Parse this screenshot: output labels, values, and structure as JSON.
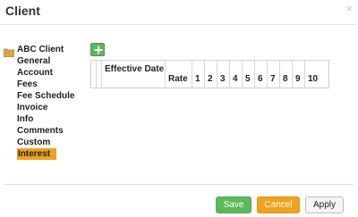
{
  "dialog": {
    "title": "Client",
    "close_glyph": "×"
  },
  "sidebar": {
    "root": {
      "label": "ABC Client",
      "icon": "folder-icon"
    },
    "items": [
      {
        "label": "General"
      },
      {
        "label": "Account"
      },
      {
        "label": "Fees"
      },
      {
        "label": "Fee Schedule"
      },
      {
        "label": "Invoice"
      },
      {
        "label": "Info"
      },
      {
        "label": "Comments"
      },
      {
        "label": "Custom"
      },
      {
        "label": "Interest",
        "selected": true
      }
    ]
  },
  "toolbar": {
    "add_icon": "plus-icon"
  },
  "grid": {
    "columns": [
      {
        "label": ""
      },
      {
        "label": ""
      },
      {
        "label": "Effective Date"
      },
      {
        "label": "Rate"
      },
      {
        "label": "1"
      },
      {
        "label": "2"
      },
      {
        "label": "3"
      },
      {
        "label": "4"
      },
      {
        "label": "5"
      },
      {
        "label": "6"
      },
      {
        "label": "7"
      },
      {
        "label": "8"
      },
      {
        "label": "9"
      },
      {
        "label": "10"
      }
    ],
    "rows": []
  },
  "footer": {
    "save_label": "Save",
    "cancel_label": "Cancel",
    "apply_label": "Apply"
  },
  "colors": {
    "accent_orange": "#f0a21e",
    "save_green": "#5cb85c",
    "folder": "#d9a441"
  }
}
